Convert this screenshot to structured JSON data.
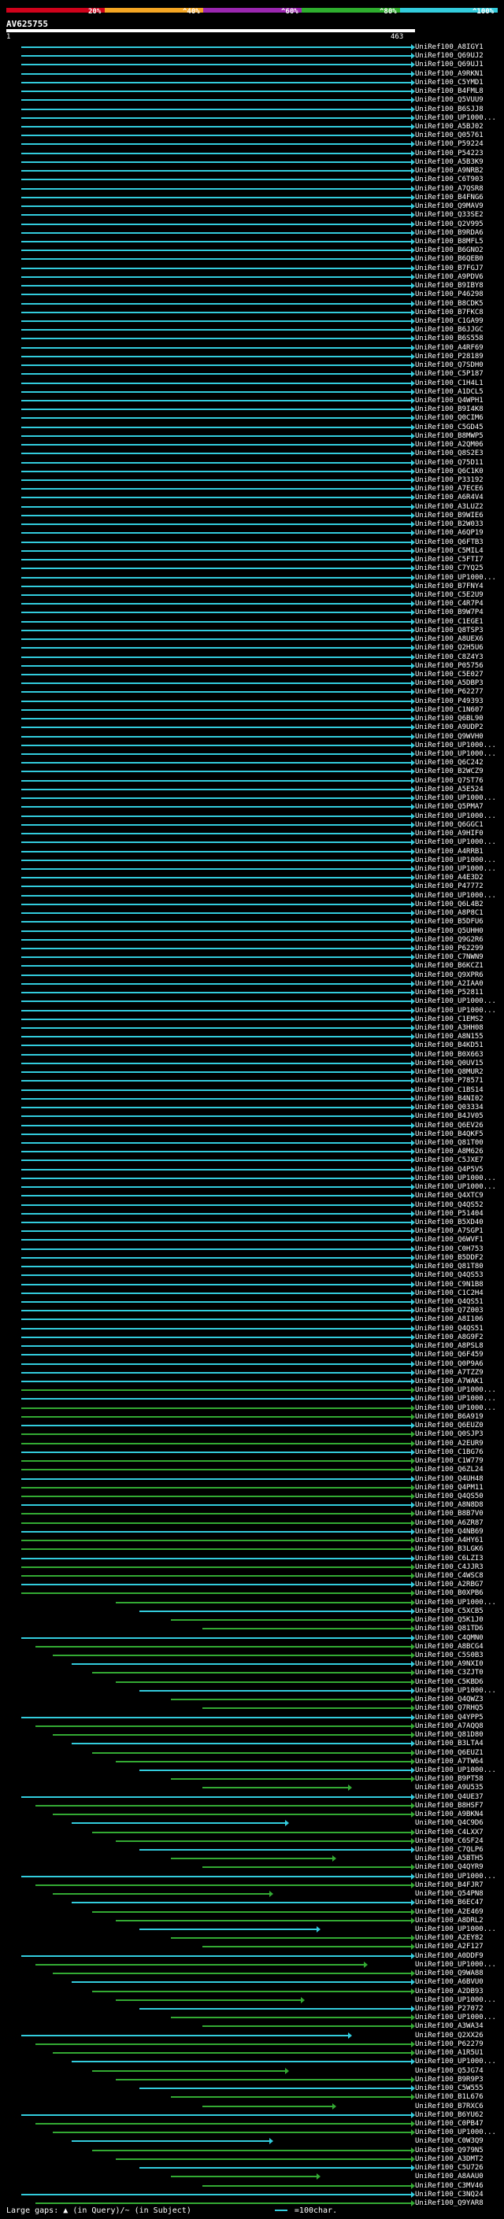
{
  "scale": {
    "labels": [
      "20%",
      "^40%",
      "^60%",
      "^80%",
      "^100%"
    ],
    "colors": [
      "#d0021b",
      "#f5a623",
      "#9b27b0",
      "#2eae2e",
      "#33ccdd"
    ]
  },
  "query": {
    "id": "AV625755",
    "start": "1",
    "end": "463"
  },
  "colors": {
    "cyan": "#33ccdd",
    "green": "#33aa33",
    "label": "#ffffff"
  },
  "hits": [
    "UniRef100_A8IGY1",
    "UniRef100_Q69UJ2",
    "UniRef100_Q69UJ1",
    "UniRef100_A9RKN1",
    "UniRef100_C5YMD1",
    "UniRef100_B4FML8",
    "UniRef100_Q5VUU9",
    "UniRef100_B6SJJ8",
    "UniRef100_UP1000...",
    "UniRef100_A5BJ02",
    "UniRef100_Q05761",
    "UniRef100_P59224",
    "UniRef100_P54223",
    "UniRef100_A5B3K9",
    "UniRef100_A9NRB2",
    "UniRef100_C6T903",
    "UniRef100_A7QSR8",
    "UniRef100_B4FNG6",
    "UniRef100_Q9MAV9",
    "UniRef100_Q33SE2",
    "UniRef100_Q2V995",
    "UniRef100_B9RDA6",
    "UniRef100_B8MFL5",
    "UniRef100_B6GNO2",
    "UniRef100_B6QEB0",
    "UniRef100_B7FGJ7",
    "UniRef100_A9PDV6",
    "UniRef100_B9IBY8",
    "UniRef100_P46298",
    "UniRef100_B8CDK5",
    "UniRef100_B7FKC8",
    "UniRef100_C1GA99",
    "UniRef100_B6JJGC",
    "UniRef100_B6S558",
    "UniRef100_A4RF69",
    "UniRef100_P28189",
    "UniRef100_Q7SDH0",
    "UniRef100_C5P187",
    "UniRef100_C1H4L1",
    "UniRef100_A1DCL5",
    "UniRef100_Q4WPH1",
    "UniRef100_B9I4K8",
    "UniRef100_Q0CIM6",
    "UniRef100_C5GD45",
    "UniRef100_B8MWP5",
    "UniRef100_A2QM06",
    "UniRef100_Q8S2E3",
    "UniRef100_Q75D11",
    "UniRef100_Q6C1K0",
    "UniRef100_P33192",
    "UniRef100_A7ECE6",
    "UniRef100_A6R4V4",
    "UniRef100_A3LUZ2",
    "UniRef100_B9WIE6",
    "UniRef100_B2W033",
    "UniRef100_A6QP19",
    "UniRef100_Q6FTB3",
    "UniRef100_C5MIL4",
    "UniRef100_C5FTI7",
    "UniRef100_C7YQ25",
    "UniRef100_UP1000...",
    "UniRef100_B7FNY4",
    "UniRef100_C5E2U9",
    "UniRef100_C4R7P4",
    "UniRef100_B9W7P4",
    "UniRef100_C1EGE1",
    "UniRef100_Q8TSP3",
    "UniRef100_A8UEX6",
    "UniRef100_Q2H5U6",
    "UniRef100_C8Z4Y3",
    "UniRef100_P05756",
    "UniRef100_C5E027",
    "UniRef100_A5DBP3",
    "UniRef100_P62277",
    "UniRef100_P49393",
    "UniRef100_C1N607",
    "UniRef100_Q6BL90",
    "UniRef100_A9UDP2",
    "UniRef100_Q9WVH0",
    "UniRef100_UP1000...",
    "UniRef100_UP1000...",
    "UniRef100_Q6C242",
    "UniRef100_B2WCZ9",
    "UniRef100_Q7ST76",
    "UniRef100_A5E524",
    "UniRef100_UP1000...",
    "UniRef100_Q5PMA7",
    "UniRef100_UP1000...",
    "UniRef100_Q6GGC1",
    "UniRef100_A9HIF0",
    "UniRef100_UP1000...",
    "UniRef100_A4RRB1",
    "UniRef100_UP1000...",
    "UniRef100_UP1000...",
    "UniRef100_A4E3D2",
    "UniRef100_P47772",
    "UniRef100_UP1000...",
    "UniRef100_Q6L4B2",
    "UniRef100_A8P8C1",
    "UniRef100_B5DFU6",
    "UniRef100_Q5UHH0",
    "UniRef100_Q9G2R6",
    "UniRef100_P62299",
    "UniRef100_C7NWN9",
    "UniRef100_B6KCZ1",
    "UniRef100_Q9XPR6",
    "UniRef100_A2IAA0",
    "UniRef100_P52811",
    "UniRef100_UP1000...",
    "UniRef100_UP1000...",
    "UniRef100_C1EMS2",
    "UniRef100_A3HH08",
    "UniRef100_A8N155",
    "UniRef100_B4KD51",
    "UniRef100_B0X663",
    "UniRef100_Q0UV15",
    "UniRef100_Q8MUR2",
    "UniRef100_P78571",
    "UniRef100_C1BS14",
    "UniRef100_B4NI02",
    "UniRef100_Q03334",
    "UniRef100_B4JV05",
    "UniRef100_Q6EV26",
    "UniRef100_B4QKF5",
    "UniRef100_Q81T00",
    "UniRef100_A8M626",
    "UniRef100_C5JXE7",
    "UniRef100_Q4P5V5",
    "UniRef100_UP1000...",
    "UniRef100_UP1000...",
    "UniRef100_Q4XTC9",
    "UniRef100_Q4QS52",
    "UniRef100_P51404",
    "UniRef100_B5XD40",
    "UniRef100_A7SGP1",
    "UniRef100_Q6WVF1",
    "UniRef100_C0H753",
    "UniRef100_B5DDF2",
    "UniRef100_Q81T80",
    "UniRef100_Q4QS53",
    "UniRef100_C9N1B8",
    "UniRef100_C1C2H4",
    "UniRef100_Q4QS51",
    "UniRef100_Q7Z003",
    "UniRef100_A8I106",
    "UniRef100_Q4QS51",
    "UniRef100_A8G9F2",
    "UniRef100_A8PSL8",
    "UniRef100_Q6F459",
    "UniRef100_Q0P9A6",
    "UniRef100_A7TZZ9",
    "UniRef100_A7WAK1",
    "UniRef100_UP1000...",
    "UniRef100_UP1000...",
    "UniRef100_UP1000...",
    "UniRef100_B6A919",
    "UniRef100_Q6EUZ0",
    "UniRef100_Q0SJP3",
    "UniRef100_A2EUR9",
    "UniRef100_C1BG76",
    "UniRef100_C1W779",
    "UniRef100_Q6ZL24",
    "UniRef100_Q4UH48",
    "UniRef100_Q4PM11",
    "UniRef100_Q4QS50",
    "UniRef100_A8N8D8",
    "UniRef100_B8B7V0",
    "UniRef100_A6ZR87",
    "UniRef100_Q4NB69",
    "UniRef100_A4HY61",
    "UniRef100_B3LGK6",
    "UniRef100_C6LZI3",
    "UniRef100_C4JJR3",
    "UniRef100_C4WSC8",
    "UniRef100_A2RBG7",
    "UniRef100_B0XPB6",
    "UniRef100_UP1000...",
    "UniRef100_C5XCB5",
    "UniRef100_Q5K1J0",
    "UniRef100_Q81TD6",
    "UniRef100_C4QMN0",
    "UniRef100_A8BCG4",
    "UniRef100_C5S0B3",
    "UniRef100_A9NXI0",
    "UniRef100_C3ZJT0",
    "UniRef100_C5KBD6",
    "UniRef100_UP1000...",
    "UniRef100_Q4QWZ3",
    "UniRef100_Q7RHQ5",
    "UniRef100_Q4YPP5",
    "UniRef100_A7AQQ8",
    "UniRef100_Q81D80",
    "UniRef100_B3LTA4",
    "UniRef100_Q6EUZ1",
    "UniRef100_A7TW64",
    "UniRef100_UP1000...",
    "UniRef100_B9PT58",
    "UniRef100_A9U535",
    "UniRef100_Q4UE37",
    "UniRef100_B8HSF7",
    "UniRef100_A9BKN4",
    "UniRef100_Q4C9D6",
    "UniRef100_C4LXX7",
    "UniRef100_C6SF24",
    "UniRef100_C7QLP6",
    "UniRef100_A5BTH5",
    "UniRef100_Q4QYR9",
    "UniRef100_UP1000...",
    "UniRef100_B4FJR7",
    "UniRef100_Q54PN8",
    "UniRef100_B6EC47",
    "UniRef100_A2E469",
    "UniRef100_A8DRL2",
    "UniRef100_UP1000...",
    "UniRef100_A2EY82",
    "UniRef100_A2F127",
    "UniRef100_A0DDF9",
    "UniRef100_UP1000...",
    "UniRef100_Q9WA88",
    "UniRef100_A6BVU0",
    "UniRef100_A2DB93",
    "UniRef100_UP1000...",
    "UniRef100_P27072",
    "UniRef100_UP1000...",
    "UniRef100_A3WA34",
    "UniRef100_Q2XX26",
    "UniRef100_P62279",
    "UniRef100_A1R5U1",
    "UniRef100_UP1000...",
    "UniRef100_Q5JG74",
    "UniRef100_B9R9P3",
    "UniRef100_C5W555",
    "UniRef100_B1L676",
    "UniRef100_B7RXC6",
    "UniRef100_B6YU62",
    "UniRef100_C0PB47",
    "UniRef100_UP1000...",
    "UniRef100_C0W3Q9",
    "UniRef100_Q979N5",
    "UniRef100_A3DMT2",
    "UniRef100_C5U726",
    "UniRef100_A8AAU0",
    "UniRef100_C3MV46",
    "UniRef100_C3NQ24",
    "UniRef100_Q9YAR8"
  ],
  "footer": {
    "large_gaps": "Large gaps:",
    "gap_legend": "(in Query)/~ (in Subject)",
    "scale_legend": "=100char."
  }
}
